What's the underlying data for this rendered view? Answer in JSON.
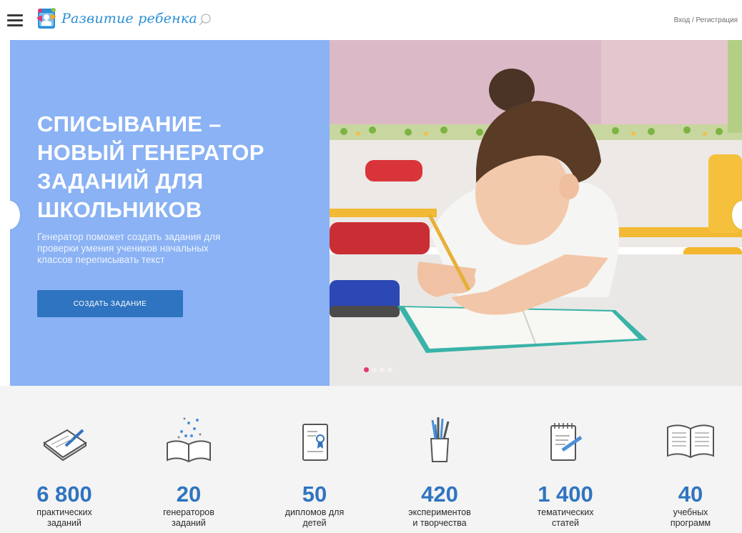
{
  "header": {
    "logo_text": "Развитие ребенка",
    "login_text": "Вход / Регистрация",
    "menu_icon": "hamburger-icon",
    "search_icon": "search-icon"
  },
  "hero": {
    "title_lines": [
      "СПИСЫВАНИЕ –",
      "НОВЫЙ ГЕНЕРАТОР",
      "ЗАДАНИЙ ДЛЯ",
      "ШКОЛЬНИКОВ"
    ],
    "description_lines": [
      "Генератор поможет создать задания для",
      "проверки умения учеников начальных",
      "классов переписывать текст"
    ],
    "button_label": "СОЗДАТЬ ЗАДАНИЕ",
    "slides_count": 4,
    "active_slide": 1,
    "bg_color": "#8ab2f4",
    "button_color": "#2f74c0"
  },
  "stats": [
    {
      "icon": "notebook-pencil-icon",
      "number": "6 800",
      "label_lines": [
        "практических",
        "заданий"
      ]
    },
    {
      "icon": "open-book-icon",
      "number": "20",
      "label_lines": [
        "генераторов",
        "заданий"
      ]
    },
    {
      "icon": "diploma-icon",
      "number": "50",
      "label_lines": [
        "дипломов для",
        "детей"
      ]
    },
    {
      "icon": "pencil-cup-icon",
      "number": "420",
      "label_lines": [
        "экспериментов",
        "и творчества"
      ]
    },
    {
      "icon": "notepad-icon",
      "number": "1 400",
      "label_lines": [
        "тематических",
        "статей"
      ]
    },
    {
      "icon": "book-icon",
      "number": "40",
      "label_lines": [
        "учебных",
        "программ"
      ]
    }
  ]
}
